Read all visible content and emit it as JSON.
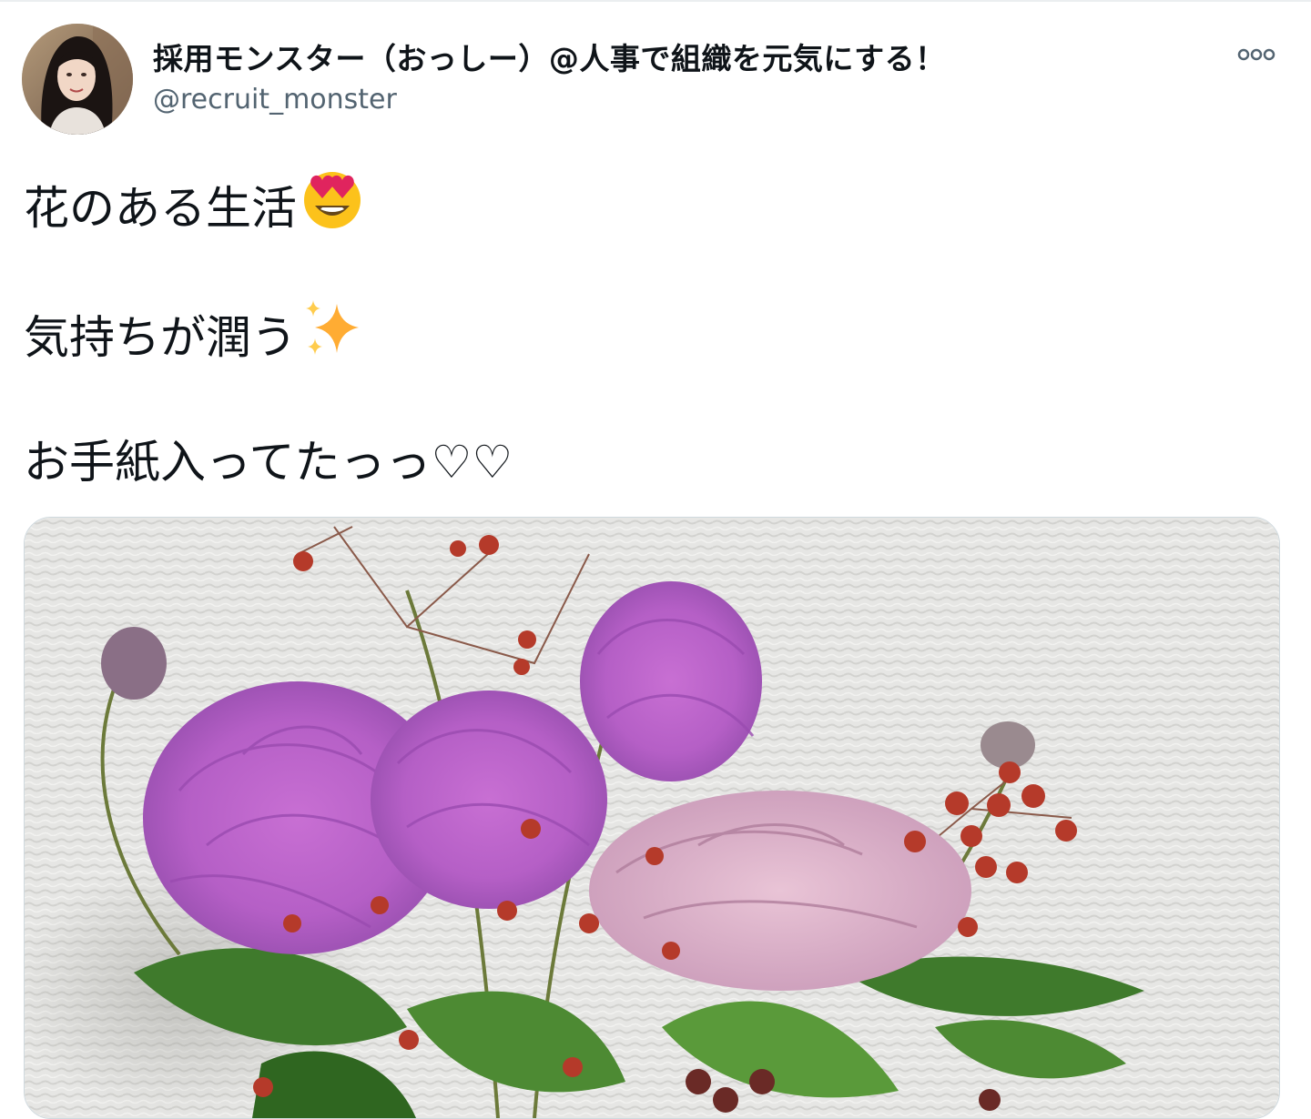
{
  "tweet": {
    "author": {
      "display_name": "採用モンスター（おっしー）@人事で組織を元気にする！",
      "handle": "@recruit_monster"
    },
    "more_icon": "more-horizontal-icon",
    "lines": [
      {
        "text": "花のある生活",
        "emoji": "smiling-face-with-heart-eyes-icon"
      },
      {
        "text": "気持ちが潤う",
        "emoji": "sparkles-icon"
      },
      {
        "text": "お手紙入ってたっっ♡♡",
        "emoji": ""
      }
    ],
    "media": {
      "kind": "photo",
      "subject": "flower-bouquet-photo"
    }
  },
  "colors": {
    "text_primary": "#0f1419",
    "text_secondary": "#536471",
    "border": "#cfd9de"
  }
}
